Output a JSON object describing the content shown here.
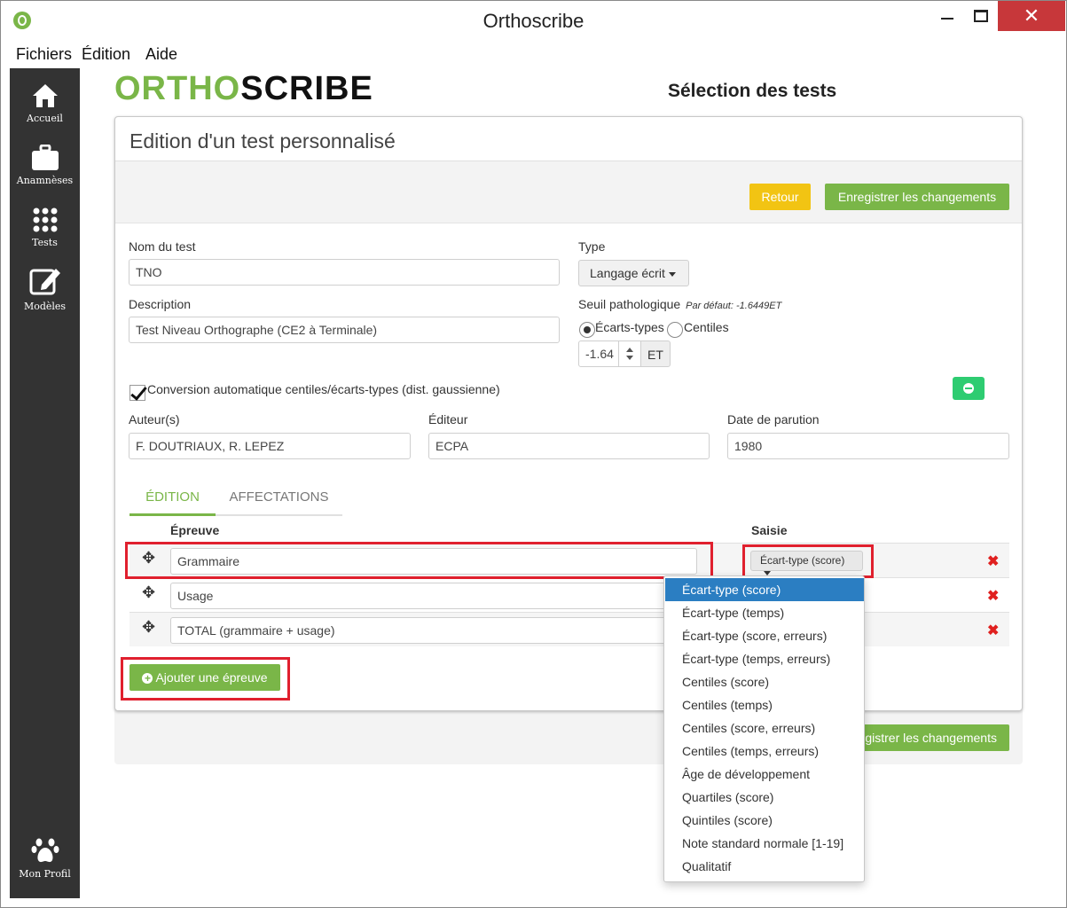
{
  "window": {
    "title": "Orthoscribe",
    "close": "✕"
  },
  "menubar": [
    "Fichiers",
    "Édition",
    "Aide"
  ],
  "sidebar": [
    {
      "label": "Accueil",
      "icon": "home-icon"
    },
    {
      "label": "Anamnèses",
      "icon": "briefcase-icon"
    },
    {
      "label": "Tests",
      "icon": "grid-icon"
    },
    {
      "label": "Modèles",
      "icon": "edit-icon"
    },
    {
      "label": "Mon Profil",
      "icon": "paw-icon"
    }
  ],
  "logo": {
    "part1": "ORTHO",
    "part2": "SCRIBE"
  },
  "page_heading": "Sélection des tests",
  "card": {
    "title": "Edition d'un test personnalisé",
    "back_button": "Retour",
    "save_button": "Enregistrer les changements",
    "save_button_partial": "gistrer les changements"
  },
  "form": {
    "name_label": "Nom du test",
    "name_value": "TNO",
    "description_label": "Description",
    "description_value": "Test Niveau Orthographe (CE2 à Terminale)",
    "type_label": "Type",
    "type_value": "Langage écrit",
    "threshold_label": "Seuil pathologique",
    "threshold_default": "Par défaut: -1.6449ET",
    "radio_sd": "Écarts-types",
    "radio_centile": "Centiles",
    "threshold_value": "-1.64",
    "threshold_unit": "ET",
    "conversion_label": "Conversion automatique centiles/écarts-types (dist. gaussienne)",
    "author_label": "Auteur(s)",
    "author_value": "F. DOUTRIAUX, R. LEPEZ",
    "publisher_label": "Éditeur",
    "publisher_value": "ECPA",
    "date_label": "Date de parution",
    "date_value": "1980"
  },
  "tabs": [
    "ÉDITION",
    "AFFECTATIONS"
  ],
  "table": {
    "col_epreuve": "Épreuve",
    "col_saisie": "Saisie",
    "rows": [
      "Grammaire",
      "Usage",
      "TOTAL (grammaire + usage)"
    ],
    "saisie_value": "Écart-type (score)",
    "add_button": "Ajouter une épreuve"
  },
  "saisie_options": [
    "Écart-type (score)",
    "Écart-type (temps)",
    "Écart-type (score, erreurs)",
    "Écart-type (temps, erreurs)",
    "Centiles (score)",
    "Centiles (temps)",
    "Centiles (score, erreurs)",
    "Centiles (temps, erreurs)",
    "Âge de développement",
    "Quartiles (score)",
    "Quintiles (score)",
    "Note standard normale [1-19]",
    "Qualitatif"
  ],
  "colors": {
    "brand_green": "#7ab648",
    "warning_yellow": "#f2c413",
    "highlight_red": "#e0202e",
    "select_blue": "#2b7ec2"
  }
}
